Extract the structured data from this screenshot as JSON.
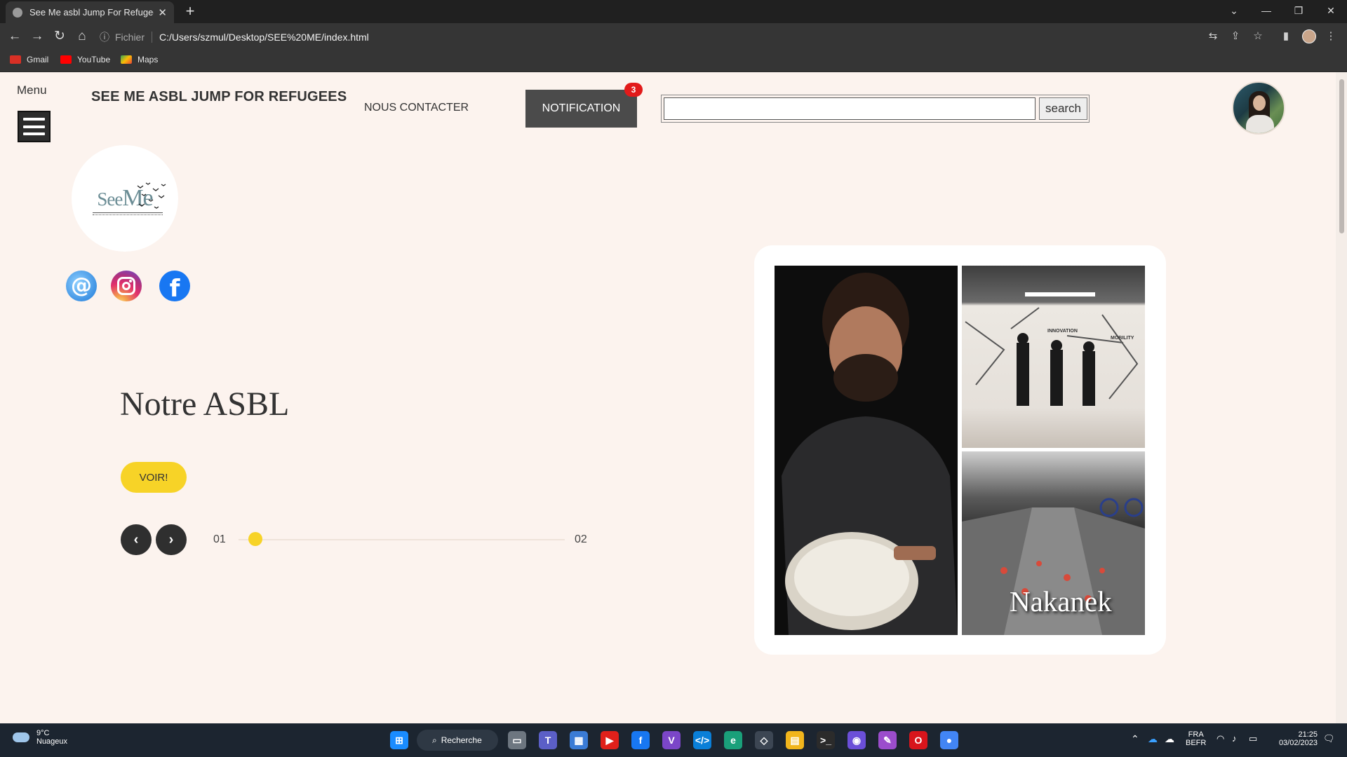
{
  "browser": {
    "tab_title": "See Me asbl Jump For Refugees",
    "address_scheme": "Fichier",
    "address_url": "C:/Users/szmul/Desktop/SEE%20ME/index.html",
    "bookmarks": [
      {
        "label": "Gmail",
        "color": "#d93025"
      },
      {
        "label": "YouTube",
        "color": "#ff0000"
      },
      {
        "label": "Maps",
        "color": "#34a853"
      }
    ]
  },
  "header": {
    "menu_label": "Menu",
    "site_title": "SEE ME ASBL JUMP FOR REFUGEES",
    "contact_link": "NOUS CONTACTER",
    "notification_label": "NOTIFICATION",
    "notification_count": "3",
    "search_value": "",
    "search_button": "search"
  },
  "logo": {
    "text_see": "See",
    "text_me": "Me"
  },
  "hero": {
    "title": "Notre ASBL",
    "cta_label": "VOIR!",
    "slide_current": "01",
    "slide_total": "02",
    "progress": 0.05
  },
  "gallery": {
    "label": "Nakanek"
  },
  "taskbar": {
    "temperature": "9°C",
    "weather": "Nuageux",
    "search_label": "Recherche",
    "language": "FRA",
    "layout": "BEFR",
    "time": "21:25",
    "date": "03/02/2023"
  },
  "colors": {
    "page_background": "#fcf3ee",
    "accent_yellow": "#f7d327",
    "notification_bg": "#4b4b4b",
    "badge_red": "#e21a1a"
  }
}
